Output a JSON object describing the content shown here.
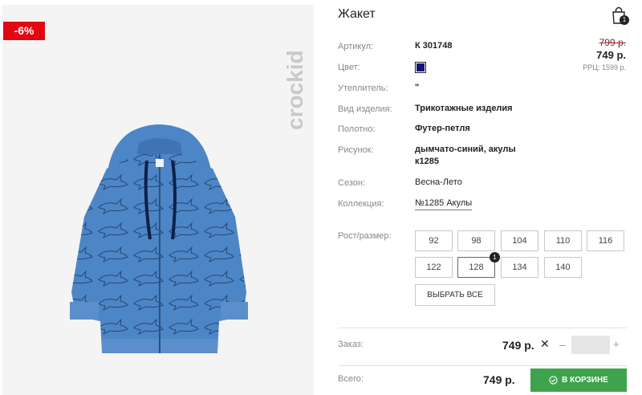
{
  "product": {
    "discount_badge": "-6%",
    "title": "Жакет",
    "brand_logo_text": "crockid",
    "cart_count": "1"
  },
  "pricing": {
    "old_price": "799 р.",
    "price": "749 р.",
    "rrp": "РРЦ: 1599 р."
  },
  "attributes": {
    "article_label": "Артикул:",
    "article_value": "К 301748",
    "color_label": "Цвет:",
    "color_swatch": "#141470",
    "insulation_label": "Утеплитель:",
    "insulation_value": "\"",
    "type_label": "Вид изделия:",
    "type_value": "Трикотажные изделия",
    "fabric_label": "Полотно:",
    "fabric_value": "Футер-петля",
    "pattern_label": "Рисунок:",
    "pattern_value_line1": "дымчато-синий, акулы",
    "pattern_value_line2": "к1285",
    "season_label": "Сезон:",
    "season_value": "Весна-Лето",
    "collection_label": "Коллекция:",
    "collection_value": "№1285 Акулы"
  },
  "sizes": {
    "label": "Рост/размер:",
    "row1": [
      "92",
      "98",
      "104",
      "110",
      "116"
    ],
    "row2": [
      "122",
      "128",
      "134",
      "140"
    ],
    "selected": "128",
    "selected_count": "1",
    "select_all": "ВЫБРАТЬ ВСЕ"
  },
  "order": {
    "label": "Заказ:",
    "price": "749 р.",
    "remove_symbol": "✕",
    "minus": "–",
    "plus": "+",
    "quantity": ""
  },
  "total": {
    "label": "Всего:",
    "price": "749 р.",
    "cart_button": "В КОРЗИНЕ"
  },
  "colors": {
    "discount_red": "#e30613",
    "cart_green": "#3fa34d",
    "jacket_blue": "#4d86c6"
  }
}
